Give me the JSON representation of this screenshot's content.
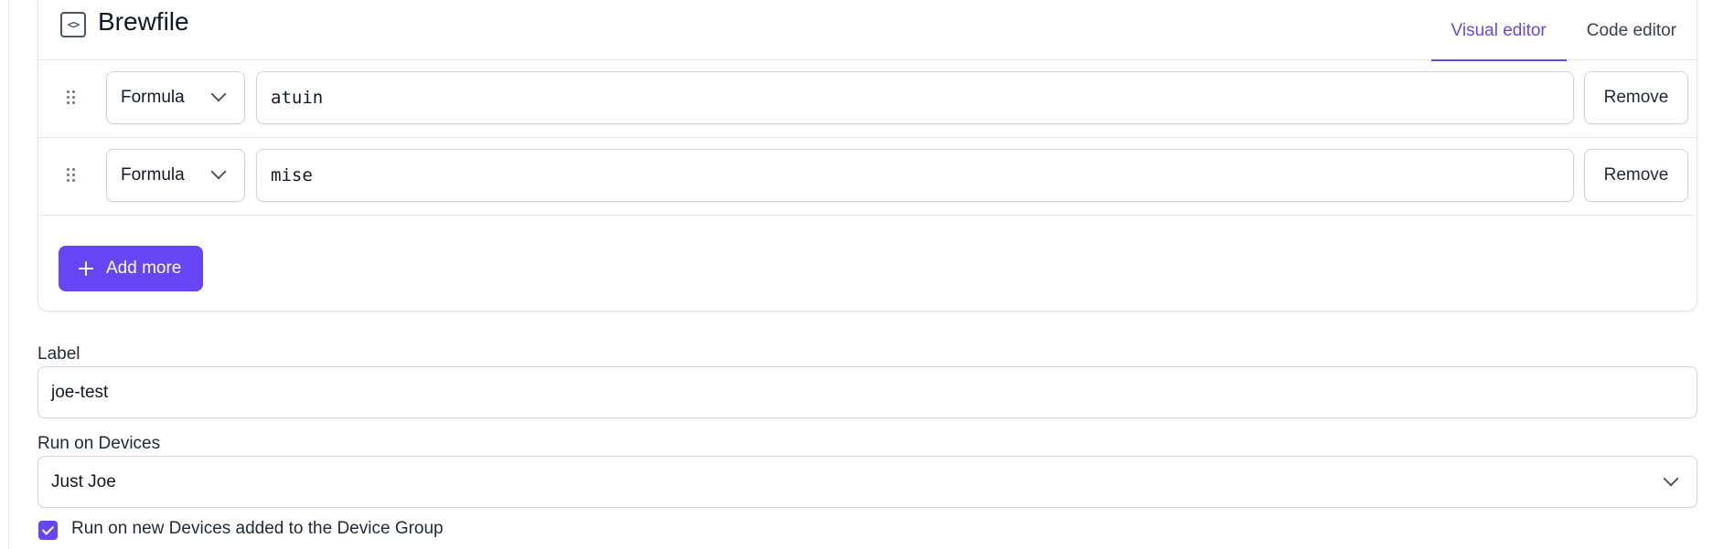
{
  "brewfile": {
    "title": "Brewfile",
    "icon": "code-brackets-icon",
    "tabs": [
      {
        "label": "Visual editor",
        "active": true
      },
      {
        "label": "Code editor",
        "active": false
      }
    ],
    "entries": [
      {
        "type": "Formula",
        "value": "atuin",
        "remove_label": "Remove"
      },
      {
        "type": "Formula",
        "value": "mise",
        "remove_label": "Remove"
      }
    ],
    "add_more_label": "Add more"
  },
  "label_field": {
    "label": "Label",
    "value": "joe-test"
  },
  "devices_field": {
    "label": "Run on Devices",
    "value": "Just Joe"
  },
  "new_devices_checkbox": {
    "label": "Run on new Devices added to the Device Group",
    "checked": true
  },
  "colors": {
    "accent": "#6546f5",
    "border": "#d1d5db"
  }
}
